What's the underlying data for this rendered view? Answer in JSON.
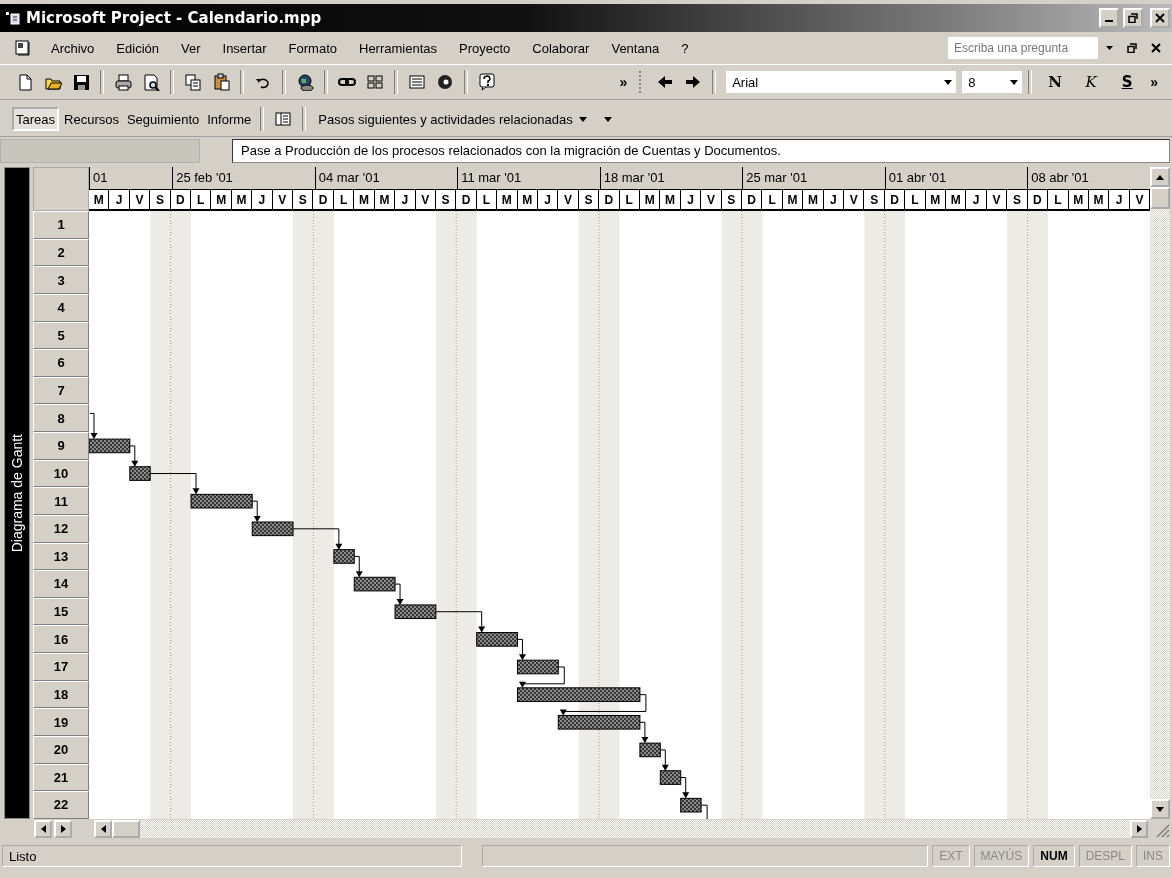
{
  "window": {
    "title": "Microsoft Project - Calendario.mpp"
  },
  "menu": [
    "Archivo",
    "Edición",
    "Ver",
    "Insertar",
    "Formato",
    "Herramientas",
    "Proyecto",
    "Colaborar",
    "Ventana",
    "?"
  ],
  "help_box": {
    "placeholder": "Escriba una pregunta"
  },
  "standard_toolbar": {
    "overflow": "»"
  },
  "formatting_toolbar": {
    "font": "Arial",
    "size": "8",
    "bold": "N",
    "italic": "K",
    "underline": "S",
    "overflow": "»"
  },
  "guide_toolbar": {
    "tabs": [
      {
        "label": "Tareas",
        "selected": true
      },
      {
        "label": "Recursos",
        "selected": false
      },
      {
        "label": "Seguimiento",
        "selected": false
      },
      {
        "label": "Informe",
        "selected": false
      }
    ],
    "activities": "Pasos siguientes y actividades relacionadas"
  },
  "entry_bar": {
    "value": "Pase a Producción de los procesos relacionados con la migración de Cuentas y Documentos."
  },
  "gantt": {
    "view_label": "Diagrama de Gantt",
    "weeks": [
      {
        "label": "01",
        "days": [
          "M",
          "J",
          "V",
          "S"
        ]
      },
      {
        "label": "25 feb '01",
        "days": [
          "D",
          "L",
          "M",
          "M",
          "J",
          "V",
          "S"
        ]
      },
      {
        "label": "04 mar '01",
        "days": [
          "D",
          "L",
          "M",
          "M",
          "J",
          "V",
          "S"
        ]
      },
      {
        "label": "11 mar '01",
        "days": [
          "D",
          "L",
          "M",
          "M",
          "J",
          "V",
          "S"
        ]
      },
      {
        "label": "18 mar '01",
        "days": [
          "D",
          "L",
          "M",
          "M",
          "J",
          "V",
          "S"
        ]
      },
      {
        "label": "25 mar '01",
        "days": [
          "D",
          "L",
          "M",
          "M",
          "J",
          "V",
          "S"
        ]
      },
      {
        "label": "01 abr '01",
        "days": [
          "D",
          "L",
          "M",
          "M",
          "J",
          "V",
          "S"
        ]
      },
      {
        "label": "08 abr '01",
        "days": [
          "D",
          "L",
          "M",
          "M",
          "J",
          "V"
        ]
      }
    ],
    "rows": [
      "1",
      "2",
      "3",
      "4",
      "5",
      "6",
      "7",
      "8",
      "9",
      "10",
      "11",
      "12",
      "13",
      "14",
      "15",
      "16",
      "17",
      "18",
      "19",
      "20",
      "21",
      "22"
    ]
  },
  "status_bar": {
    "message": "Listo",
    "indicators": [
      {
        "label": "EXT",
        "on": false
      },
      {
        "label": "MAYÚS",
        "on": false
      },
      {
        "label": "NUM",
        "on": true
      },
      {
        "label": "DESPL",
        "on": false
      },
      {
        "label": "INS",
        "on": false
      }
    ]
  }
}
